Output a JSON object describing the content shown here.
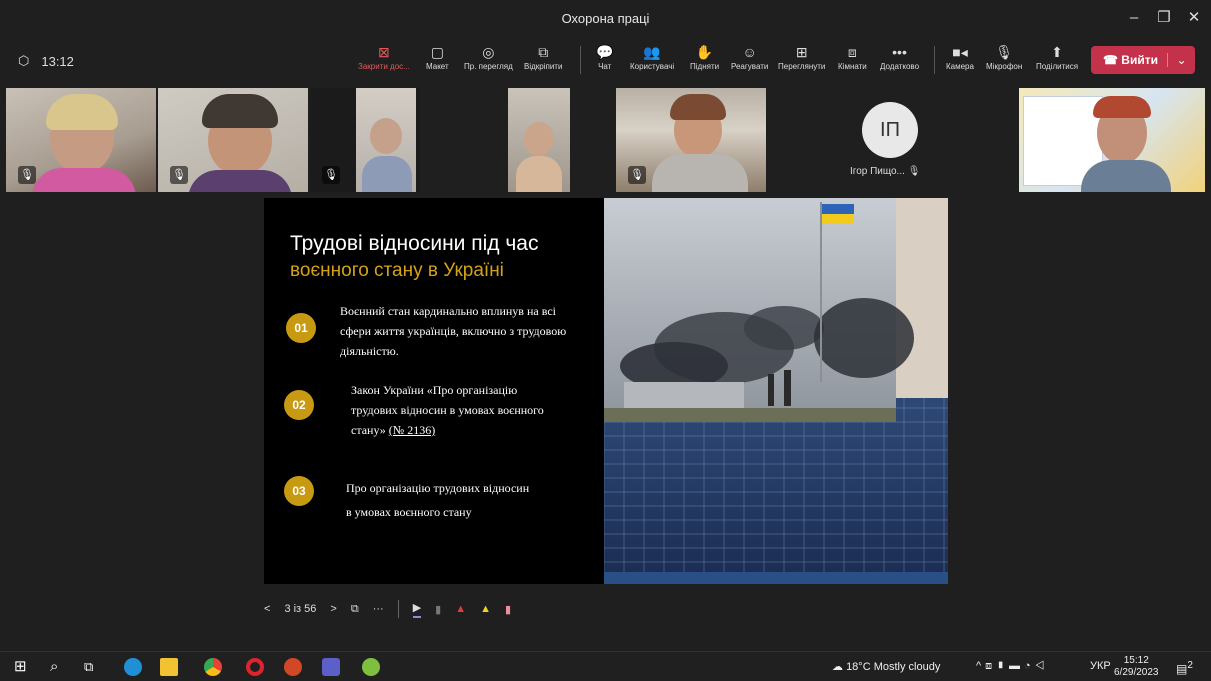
{
  "window": {
    "title": "Охорона праці"
  },
  "meeting": {
    "timer": "13:12"
  },
  "toolbar": {
    "stop_share": "Закрити дос...",
    "layout": "Макет",
    "view": "Пр. перегляд",
    "unpin": "Відкріпити",
    "chat": "Чат",
    "people": "Користувачі",
    "raise": "Підняти",
    "react": "Реагувати",
    "view2": "Переглянути",
    "rooms": "Кімнати",
    "more": "Додатково",
    "camera": "Камера",
    "mic": "Мікрофон",
    "share": "Поділитися",
    "leave": "Вийти"
  },
  "participants": {
    "avatar_initials": "ІП",
    "avatar_name": "Ігор Пищо..."
  },
  "slide": {
    "title_line1": "Трудові відносини під час",
    "title_line2": "воєнного стану в Україні",
    "items": [
      {
        "num": "01",
        "l1": "Воєнний стан кардинально вплинув на всі",
        "l2": "сфери життя українців, включно з трудовою",
        "l3": "діяльністю."
      },
      {
        "num": "02",
        "l1": "Закон України «Про організацію",
        "l2": "трудових відносин в умовах воєнного",
        "l3": "стану»",
        "link": "(№ 2136)"
      },
      {
        "num": "03",
        "l1": "Про організацію трудових відносин",
        "l2": "в умовах воєнного стану"
      }
    ]
  },
  "presenter": {
    "page": "3 із 56"
  },
  "taskbar": {
    "weather": "18°C  Mostly cloudy",
    "lang": "УКР",
    "time": "15:12",
    "date": "6/29/2023",
    "notif": "2"
  },
  "colors": {
    "accent_gold": "#c79a12",
    "leave_red": "#c4314b",
    "stop_red": "#e35a5a"
  }
}
